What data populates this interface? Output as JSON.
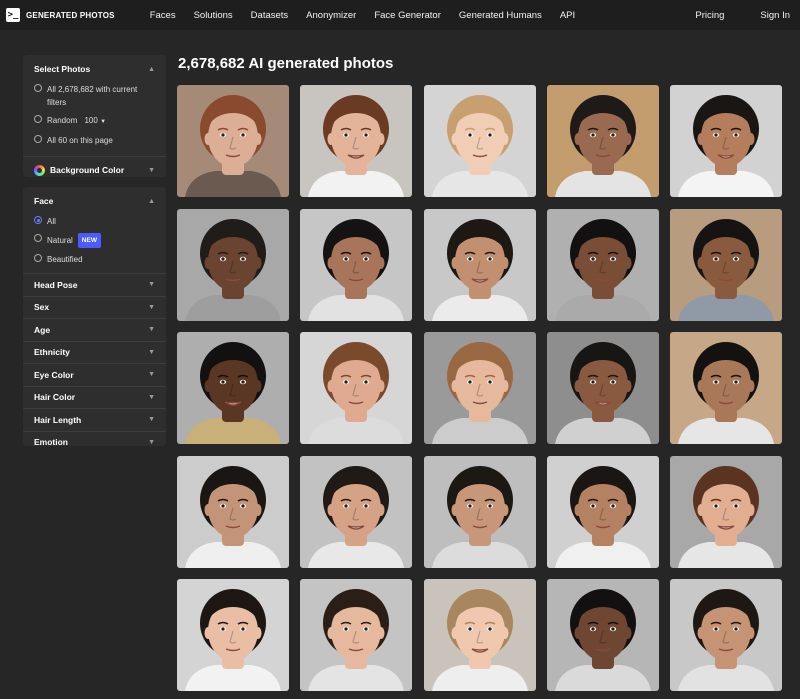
{
  "brand": {
    "logo_glyph": ">_",
    "name": "GENERATED PHOTOS"
  },
  "nav": {
    "links": [
      "Faces",
      "Solutions",
      "Datasets",
      "Anonymizer",
      "Face Generator",
      "Generated Humans",
      "API"
    ],
    "pricing": "Pricing",
    "signin": "Sign In"
  },
  "sidebar": {
    "select": {
      "title": "Select Photos",
      "all_line1": "All 2,678,682 with current",
      "all_line2": "filters",
      "random_label": "Random",
      "random_value": "100",
      "page_label": "All 60 on this page",
      "bg_color": "Background Color"
    },
    "face": {
      "title": "Face",
      "options": [
        "All",
        "Natural",
        "Beautified"
      ],
      "new_badge": "NEW",
      "filters": [
        "Head Pose",
        "Sex",
        "Age",
        "Ethnicity",
        "Eye Color",
        "Hair Color",
        "Hair Length",
        "Emotion"
      ]
    }
  },
  "main": {
    "title": "2,678,682 AI generated photos"
  },
  "photos": [
    {
      "bg": "#a58a78",
      "skin": "#dcae96",
      "hair": "#8a4a30",
      "shirt": "#6a5a50"
    },
    {
      "bg": "#c8c4c0",
      "skin": "#e4b49a",
      "hair": "#6a3a22",
      "shirt": "#f2f2f2"
    },
    {
      "bg": "#d4d4d4",
      "skin": "#f0cdb4",
      "hair": "#c8a070",
      "shirt": "#e6e6e6"
    },
    {
      "bg": "#c39d6e",
      "skin": "#9a6a50",
      "hair": "#1e1a18",
      "shirt": "#e4e4e4"
    },
    {
      "bg": "#d2d2d2",
      "skin": "#b47e5c",
      "hair": "#1a1614",
      "shirt": "#f4f4f4"
    },
    {
      "bg": "#a8a8a8",
      "skin": "#6a4430",
      "hair": "#201c1a",
      "shirt": "#9e9e9e"
    },
    {
      "bg": "#c6c6c6",
      "skin": "#a8745a",
      "hair": "#141212",
      "shirt": "#e2e2e2"
    },
    {
      "bg": "#c8c8c8",
      "skin": "#c29070",
      "hair": "#1e1814",
      "shirt": "#ebebeb"
    },
    {
      "bg": "#b0b0b0",
      "skin": "#7a4e36",
      "hair": "#121010",
      "shirt": "#aaaaaa"
    },
    {
      "bg": "#b89c80",
      "skin": "#8a5a3e",
      "hair": "#161412",
      "shirt": "#909aa6"
    },
    {
      "bg": "#aeaeae",
      "skin": "#5a3624",
      "hair": "#121010",
      "shirt": "#c8b078"
    },
    {
      "bg": "#d6d6d6",
      "skin": "#e0aa90",
      "hair": "#7a4a2c",
      "shirt": "#dcdcdc"
    },
    {
      "bg": "#9a9a9a",
      "skin": "#e6b89e",
      "hair": "#9a6840",
      "shirt": "#cccccc"
    },
    {
      "bg": "#8e8e8e",
      "skin": "#8a5a40",
      "hair": "#181614",
      "shirt": "#d0d0d0"
    },
    {
      "bg": "#c6a888",
      "skin": "#a87858",
      "hair": "#141210",
      "shirt": "#e6e6e6"
    },
    {
      "bg": "#cccccc",
      "skin": "#c49478",
      "hair": "#1a1614",
      "shirt": "#efefef"
    },
    {
      "bg": "#c2c2c2",
      "skin": "#d6a286",
      "hair": "#201a16",
      "shirt": "#e8e8e8"
    },
    {
      "bg": "#bebebe",
      "skin": "#c89678",
      "hair": "#1c1814",
      "shirt": "#dcdcdc"
    },
    {
      "bg": "#d0d0d0",
      "skin": "#b48262",
      "hair": "#1a1614",
      "shirt": "#f0f0f0"
    },
    {
      "bg": "#a8a8a8",
      "skin": "#e2ae92",
      "hair": "#5a3420",
      "shirt": "#e6e6e6"
    },
    {
      "bg": "#d4d4d4",
      "skin": "#eabea4",
      "hair": "#1e1612",
      "shirt": "#f2f2f2"
    },
    {
      "bg": "#c4c4c4",
      "skin": "#e6b89e",
      "hair": "#2a1e16",
      "shirt": "#e4e4e4"
    },
    {
      "bg": "#c9c3bb",
      "skin": "#f0c8b0",
      "hair": "#a8865e",
      "shirt": "#eeeeee"
    },
    {
      "bg": "#b6b6b6",
      "skin": "#6e4632",
      "hair": "#121010",
      "shirt": "#dadada"
    },
    {
      "bg": "#c8c8c8",
      "skin": "#c69474",
      "hair": "#1e1814",
      "shirt": "#e2e2e2"
    }
  ]
}
